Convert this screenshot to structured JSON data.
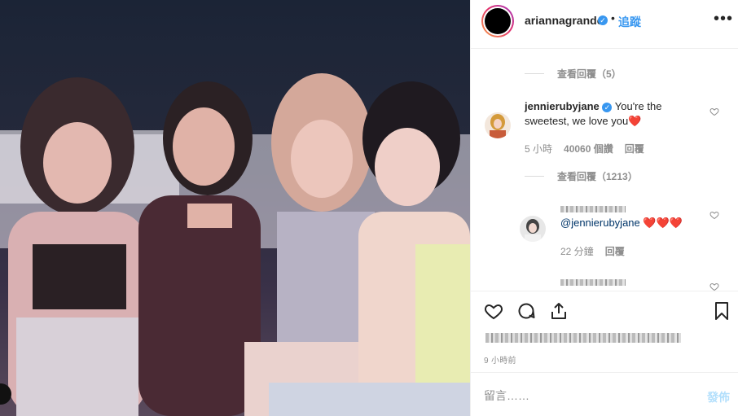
{
  "colors": {
    "accent": "#3897f0",
    "secondary_text": "#8e8e8e",
    "heart_red": "#ed4956"
  },
  "post": {
    "image_alt": ""
  },
  "header": {
    "username": "ariannagrande",
    "follow_label": "追蹤",
    "dot": "•",
    "more_icon": "more-horizontal-icon"
  },
  "comments": {
    "view_replies_1": "查看回覆（5）",
    "main_comment": {
      "username": "jennierubyjane",
      "text": "You're the sweetest, we love you",
      "time": "5 小時",
      "likes": "40060 個讚",
      "reply_label": "回覆"
    },
    "view_replies_2": "查看回覆（1213）",
    "reply_comment": {
      "mention": "@jennierubyjane",
      "hearts": "❤️❤️❤️",
      "time": "22 分鐘",
      "reply_label": "回覆"
    }
  },
  "actions": {
    "icons": [
      "heart-icon",
      "comment-icon",
      "share-icon",
      "bookmark-icon"
    ],
    "time_ago": "9 小時前"
  },
  "comment_box": {
    "placeholder": "留言……",
    "post_label": "發佈"
  }
}
